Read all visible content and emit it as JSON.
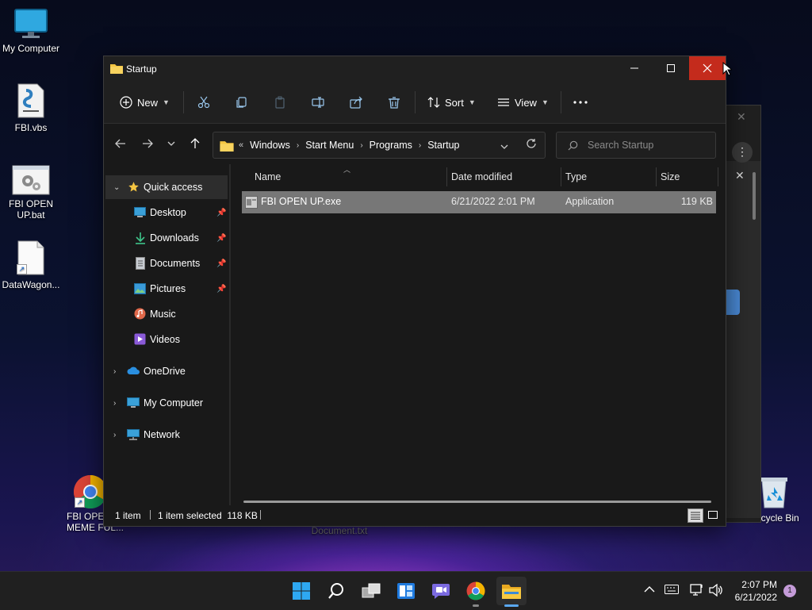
{
  "desktop": {
    "icons": [
      {
        "label": "My Computer"
      },
      {
        "label": "FBI.vbs"
      },
      {
        "label": "FBI OPEN UP.bat"
      },
      {
        "label": "DataWagon..."
      },
      {
        "label": "FBI OPEN MEME FUL..."
      },
      {
        "label": "Document.txt"
      },
      {
        "label": "Recycle Bin"
      }
    ]
  },
  "window": {
    "title": "Startup",
    "toolbar": {
      "new_label": "New",
      "sort_label": "Sort",
      "view_label": "View"
    },
    "address": {
      "crumbs": [
        "Windows",
        "Start Menu",
        "Programs",
        "Startup"
      ]
    },
    "search": {
      "placeholder": "Search Startup"
    },
    "nav": {
      "quick_access": "Quick access",
      "items": [
        {
          "label": "Desktop"
        },
        {
          "label": "Downloads"
        },
        {
          "label": "Documents"
        },
        {
          "label": "Pictures"
        },
        {
          "label": "Music"
        },
        {
          "label": "Videos"
        }
      ],
      "onedrive": "OneDrive",
      "my_computer": "My Computer",
      "network": "Network"
    },
    "columns": {
      "name": "Name",
      "date": "Date modified",
      "type": "Type",
      "size": "Size"
    },
    "files": [
      {
        "name": "FBI OPEN UP.exe",
        "date": "6/21/2022 2:01 PM",
        "type": "Application",
        "size": "119 KB"
      }
    ],
    "status": {
      "count": "1 item",
      "selected": "1 item selected  118 KB"
    }
  },
  "taskbar": {
    "time": "2:07 PM",
    "date": "6/21/2022",
    "notifications": "1"
  }
}
